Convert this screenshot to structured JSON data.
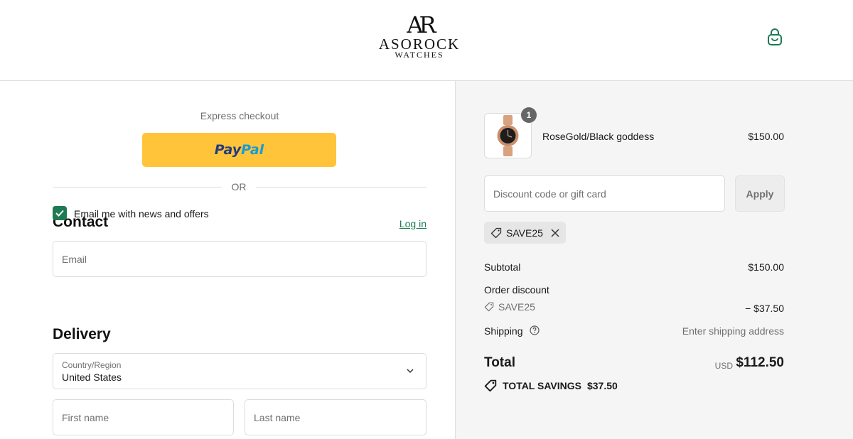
{
  "header": {
    "logo_monogram": "AR",
    "logo_brand": "ASOROCK",
    "logo_sub": "WATCHES",
    "cart_icon": "shopping-bag-icon",
    "accent_color": "#1e7a52"
  },
  "express": {
    "label": "Express checkout",
    "paypal_part1": "Pay",
    "paypal_part2": "Pal",
    "paypal_color": "#ffc439",
    "or_text": "OR"
  },
  "contact": {
    "title": "Contact",
    "login_link": "Log in",
    "email_placeholder": "Email",
    "newsletter_label": "Email me with news and offers",
    "newsletter_checked": true
  },
  "delivery": {
    "title": "Delivery",
    "country_label": "Country/Region",
    "country_value": "United States",
    "first_name_placeholder": "First name",
    "last_name_placeholder": "Last name"
  },
  "summary": {
    "product": {
      "name": "RoseGold/Black goddess",
      "price": "$150.00",
      "quantity": "1"
    },
    "discount_placeholder": "Discount code or gift card",
    "apply_label": "Apply",
    "applied_code": "SAVE25",
    "subtotal_label": "Subtotal",
    "subtotal_value": "$150.00",
    "order_discount_label": "Order discount",
    "order_discount_code": "SAVE25",
    "order_discount_value": "− $37.50",
    "shipping_label": "Shipping",
    "shipping_value": "Enter shipping address",
    "total_label": "Total",
    "total_currency": "USD",
    "total_value": "$112.50",
    "savings_label": "TOTAL SAVINGS",
    "savings_value": "$37.50"
  }
}
